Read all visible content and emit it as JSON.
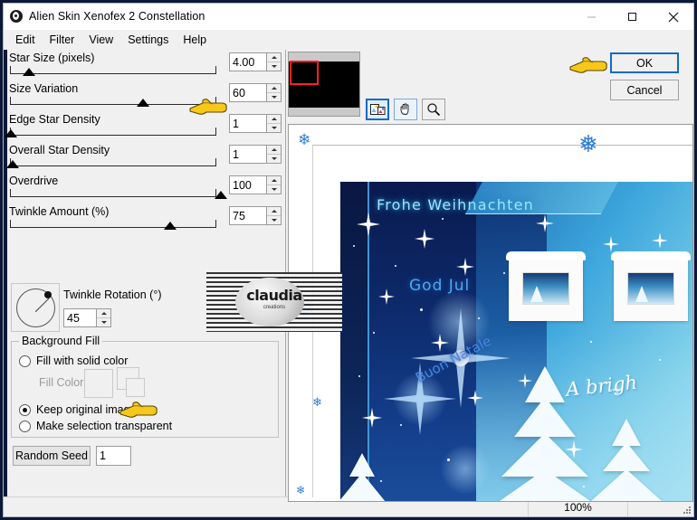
{
  "window": {
    "title": "Alien Skin Xenofex 2 Constellation",
    "app_icon": "xenofex-icon",
    "minimize": "–",
    "maximize": "□",
    "close": "✕"
  },
  "menu": {
    "items": [
      {
        "label": "Edit"
      },
      {
        "label": "Filter"
      },
      {
        "label": "View"
      },
      {
        "label": "Settings"
      },
      {
        "label": "Help"
      }
    ]
  },
  "sliders": [
    {
      "label": "Star Size (pixels)",
      "value": "4.00",
      "pos_pct": 7
    },
    {
      "label": "Size Variation",
      "value": "60",
      "pos_pct": 60
    },
    {
      "label": "Edge Star Density",
      "value": "1",
      "pos_pct": 1
    },
    {
      "label": "Overall Star Density",
      "value": "1",
      "pos_pct": 2
    },
    {
      "label": "Overdrive",
      "value": "100",
      "pos_pct": 99
    },
    {
      "label": "Twinkle Amount (%)",
      "value": "75",
      "pos_pct": 75
    }
  ],
  "dial": {
    "label": "Twinkle Rotation (°)",
    "value": "45"
  },
  "background_fill": {
    "title": "Background Fill",
    "options": [
      {
        "label": "Fill with solid color",
        "checked": false
      },
      {
        "label": "Keep original image",
        "checked": true
      },
      {
        "label": "Make selection transparent",
        "checked": false
      }
    ],
    "fill_color_label": "Fill Color"
  },
  "random_seed": {
    "button_label": "Random Seed",
    "value": "1"
  },
  "toolbar": {
    "buttons": [
      {
        "name": "navigator-icon",
        "state": "selected"
      },
      {
        "name": "pan-hand-icon",
        "state": "hover"
      },
      {
        "name": "zoom-magnifier-icon",
        "state": "normal"
      }
    ]
  },
  "actions": {
    "ok_label": "OK",
    "cancel_label": "Cancel"
  },
  "preview": {
    "card_texts": {
      "german": "Frohe Weihnachten",
      "swedish": "God Jul",
      "italian": "Buon Natale",
      "english": "A brigh"
    }
  },
  "watermark": {
    "name": "claudia",
    "sub": "creations"
  },
  "statusbar": {
    "left": "",
    "middle": "",
    "zoom": "100%"
  },
  "colors": {
    "accent": "#1569c7",
    "panel": "#f0f0f0",
    "desktop": "#0c1838",
    "pointer": "#f5c518",
    "nav_rect": "#ff2222"
  }
}
